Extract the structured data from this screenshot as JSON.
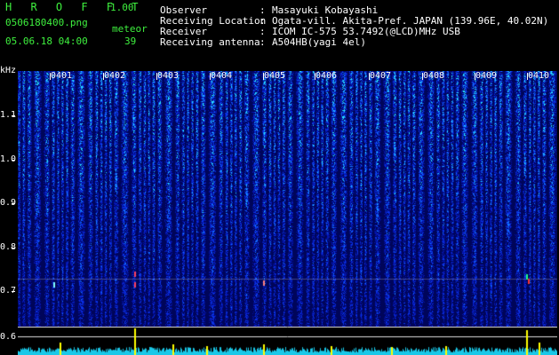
{
  "app": {
    "title": "H R O F F T",
    "version": "1.00",
    "filename": "0506180400.png",
    "datetime": "05.06.18 04:00"
  },
  "counter": {
    "label": "meteor",
    "value": "39"
  },
  "info": [
    {
      "key": "Observer",
      "value": "Masayuki Kobayashi"
    },
    {
      "key": "Receiving Location",
      "value": "Ogata-vill. Akita-Pref. JAPAN (139.96E, 40.02N)"
    },
    {
      "key": "Receiver",
      "value": "ICOM IC-575 53.7492(@LCD)MHz USB"
    },
    {
      "key": "Receiving antenna",
      "value": "A504HB(yagi 4el)"
    }
  ],
  "yaxis": {
    "unit": "kHz",
    "ticks": [
      "1.1",
      "1.0",
      "0.9",
      "0.8",
      "0.7",
      "0.6"
    ]
  },
  "time_labels": [
    "0401",
    "0402",
    "0403",
    "0404",
    "0405",
    "0406",
    "0407",
    "0408",
    "0409",
    "0410"
  ],
  "colors": {
    "background": "#000000",
    "accent": "#3ef03e",
    "strip_fill": "#19c8e8",
    "spike": "#ffff00"
  }
}
